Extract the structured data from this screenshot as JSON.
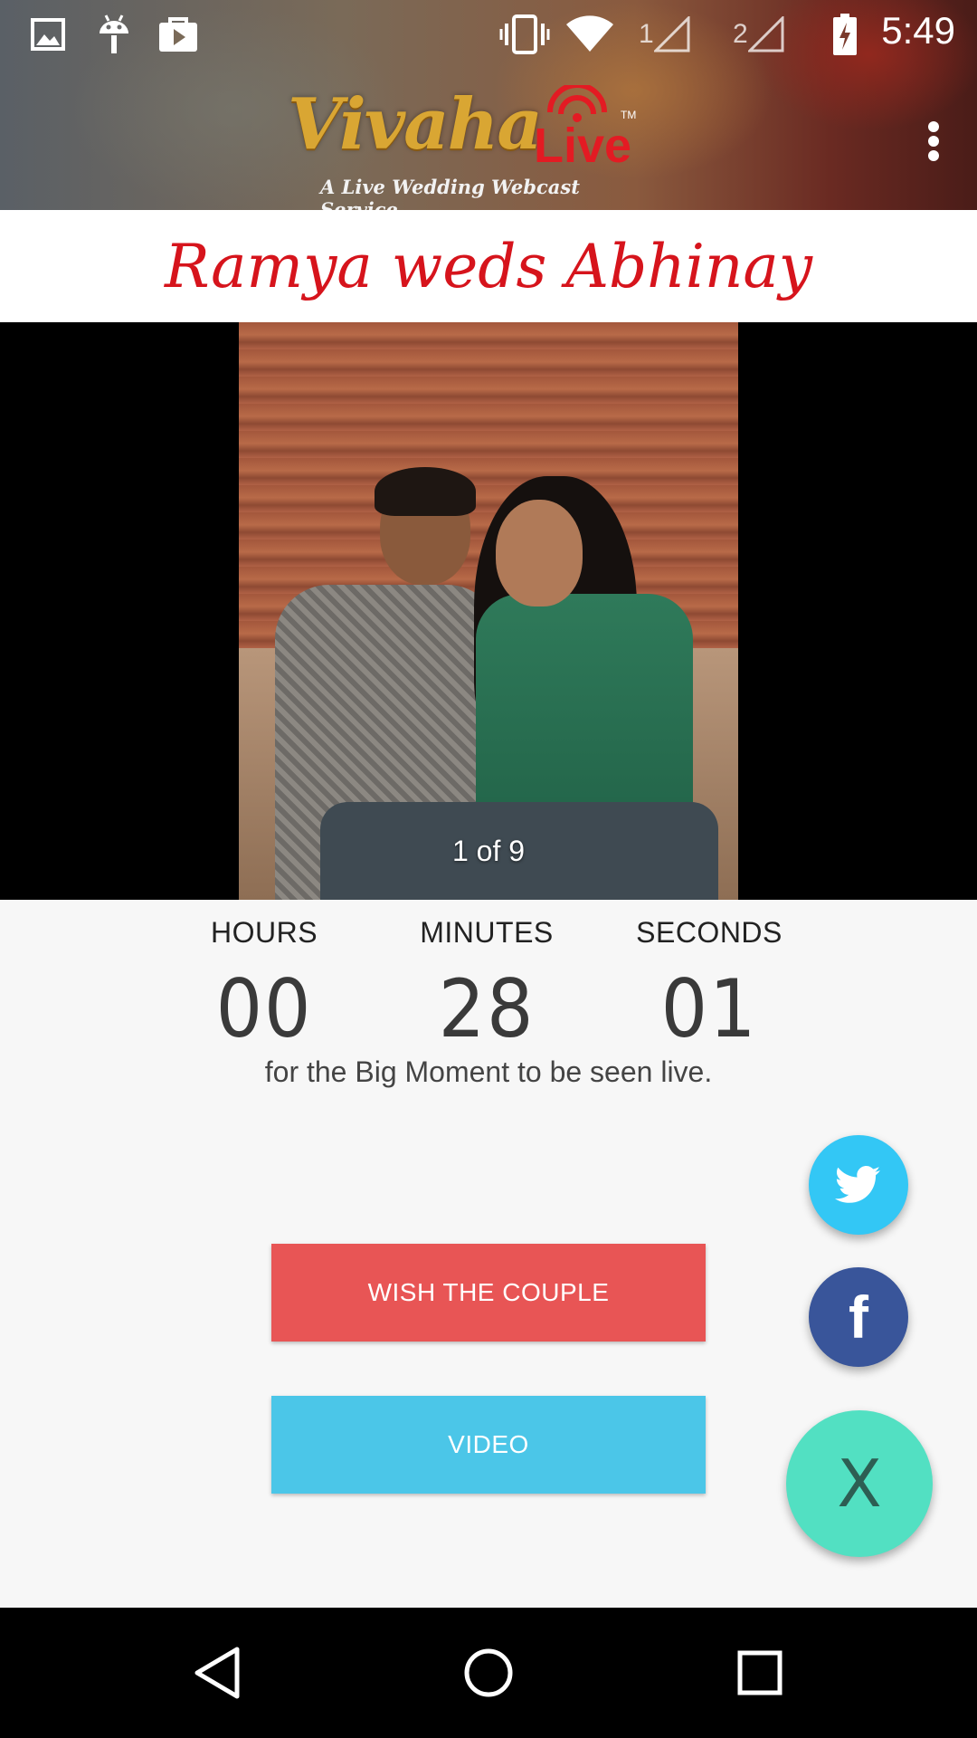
{
  "status_bar": {
    "time": "5:49",
    "sim1_label": "1",
    "sim2_label": "2",
    "icons": [
      "gallery-icon",
      "android-icon",
      "play-store-icon",
      "vibrate-icon",
      "wifi-icon",
      "signal-icon",
      "signal-icon",
      "battery-charging-icon"
    ]
  },
  "app_bar": {
    "logo_vivaha": "Vivaha",
    "logo_live": "Live",
    "logo_tm": "TM",
    "logo_tagline": "A Live Wedding Webcast Service",
    "menu_icon": "overflow-menu-icon"
  },
  "event": {
    "title": "Ramya weds Abhinay"
  },
  "gallery": {
    "counter": "1 of 9"
  },
  "countdown": {
    "hours_label": "HOURS",
    "hours_value": "00",
    "minutes_label": "MINUTES",
    "minutes_value": "28",
    "seconds_label": "SECONDS",
    "seconds_value": "01",
    "caption": "for the Big Moment to be seen live."
  },
  "actions": {
    "wish_label": "WISH THE COUPLE",
    "video_label": "VIDEO"
  },
  "fab": {
    "close_label": "X",
    "twitter_icon": "twitter-icon",
    "facebook_icon": "facebook-icon",
    "facebook_glyph": "f"
  },
  "colors": {
    "title_red": "#d6141c",
    "wish_button": "#e85555",
    "video_button": "#4bc6e8",
    "twitter_fab": "#33c7f5",
    "facebook_fab": "#39559a",
    "close_fab": "#52e0c2"
  },
  "nav_bar": {
    "icons": [
      "back-icon",
      "home-icon",
      "recents-icon"
    ]
  }
}
